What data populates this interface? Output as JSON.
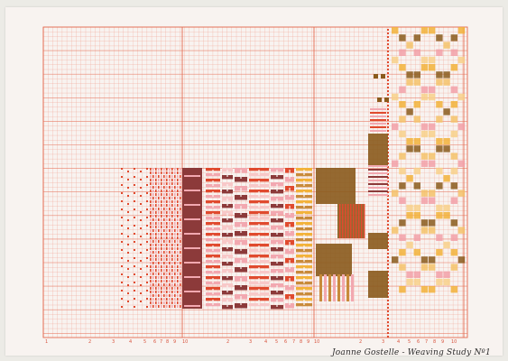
{
  "artwork": {
    "caption": "Joanne Gostelle - Weaving Study Nº1",
    "axis_labels": [
      "1",
      "2",
      "3",
      "4",
      "5",
      "6",
      "7",
      "8",
      "9",
      "10",
      "2",
      "3",
      "4",
      "5",
      "6",
      "7",
      "8",
      "9",
      "10",
      "2",
      "3",
      "4",
      "5",
      "6",
      "7",
      "8",
      "9",
      "10"
    ],
    "colors": {
      "paper": "#f8f3f0",
      "grid": "#f0a090",
      "grid_major": "#e46a50",
      "red": "#e04a2e",
      "pink": "#f2a8b0",
      "maroon": "#8c3a3a",
      "brown": "#8a5a1c",
      "tan": "#c88a3a",
      "gold": "#f2b23a",
      "light_pink": "#f8c8c8"
    }
  }
}
